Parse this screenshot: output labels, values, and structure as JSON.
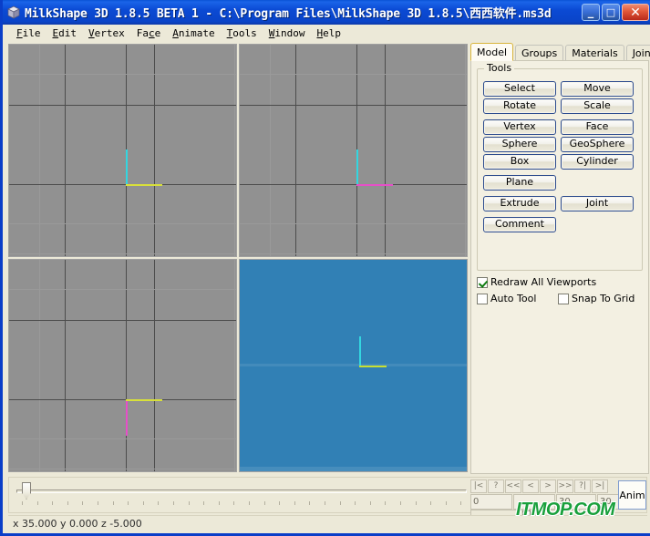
{
  "window": {
    "title": "MilkShape 3D 1.8.5 BETA 1 - C:\\Program Files\\MilkShape 3D 1.8.5\\西西软件.ms3d",
    "icon": "milkshape-cube-icon",
    "caption": {
      "minimize_label": "_",
      "maximize_label": "□",
      "close_label": "✕"
    },
    "colors": {
      "titlebar_blue": "#0b4ad4",
      "close_red": "#d2492c",
      "face_beige": "#ece9d8",
      "panel_beige": "#f3f0e2"
    }
  },
  "menubar": {
    "items": [
      {
        "pre": "",
        "key": "F",
        "post": "ile"
      },
      {
        "pre": "",
        "key": "E",
        "post": "dit"
      },
      {
        "pre": "",
        "key": "V",
        "post": "ertex"
      },
      {
        "pre": "Fa",
        "key": "c",
        "post": "e"
      },
      {
        "pre": "",
        "key": "A",
        "post": "nimate"
      },
      {
        "pre": "",
        "key": "T",
        "post": "ools"
      },
      {
        "pre": "",
        "key": "W",
        "post": "indow"
      },
      {
        "pre": "",
        "key": "H",
        "post": "elp"
      }
    ]
  },
  "viewports": [
    {
      "name": "viewport-front",
      "background": "#919191",
      "axis_vertical_color": "#33d6e0",
      "axis_horizontal_color": "#d8e03a"
    },
    {
      "name": "viewport-left",
      "background": "#919191",
      "axis_vertical_color": "#33d6e0",
      "axis_horizontal_color": "#e64fc8"
    },
    {
      "name": "viewport-top",
      "background": "#919191",
      "axis_vertical_color": "#e64fc8",
      "axis_horizontal_color": "#d8e03a"
    },
    {
      "name": "viewport-3d",
      "background": "#3180b5",
      "axis_vertical_color": "#33d6e0",
      "axis_horizontal_color": "#c8e032"
    }
  ],
  "right_panel": {
    "tabs": [
      {
        "label": "Model",
        "active": true
      },
      {
        "label": "Groups",
        "active": false
      },
      {
        "label": "Materials",
        "active": false
      },
      {
        "label": "Joints",
        "active": false
      }
    ],
    "tools_group": {
      "title": "Tools",
      "rows": [
        [
          "Select",
          "Move"
        ],
        [
          "Rotate",
          "Scale"
        ],
        [
          "Vertex",
          "Face"
        ],
        [
          "Sphere",
          "GeoSphere"
        ],
        [
          "Box",
          "Cylinder"
        ],
        [
          "Plane"
        ],
        [
          "Extrude",
          "Joint"
        ],
        [
          "Comment"
        ]
      ],
      "checkboxes": [
        {
          "label": "Redraw All Viewports",
          "checked": true
        },
        {
          "label": "Auto Tool",
          "checked": false
        },
        {
          "label": "Snap To Grid",
          "checked": false
        }
      ]
    }
  },
  "bottom_bar": {
    "playback_buttons": [
      "|<",
      "?",
      "<<",
      "<",
      ">",
      ">>",
      "?|",
      ">|"
    ],
    "fields": [
      {
        "name": "current-frame-field",
        "value": "0"
      },
      {
        "name": "total-frames-field",
        "value": ""
      },
      {
        "name": "fps-field",
        "value": "30"
      },
      {
        "name": "rate-field",
        "value": "30"
      }
    ],
    "anim_button_label": "Anim"
  },
  "statusbar": {
    "coordinates": "x 35.000 y 0.000 z -5.000"
  },
  "watermark": {
    "text": "ITMOP.COM",
    "color": "#19a03c"
  }
}
